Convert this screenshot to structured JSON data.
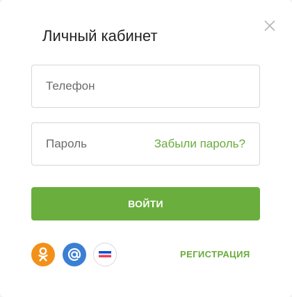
{
  "modal": {
    "title": "Личный кабинет"
  },
  "form": {
    "phone_placeholder": "Телефон",
    "password_placeholder": "Пароль",
    "forgot_label": "Забыли пароль?",
    "submit_label": "ВОЙТИ"
  },
  "footer": {
    "register_label": "РЕГИСТРАЦИЯ"
  },
  "social": [
    {
      "icon": "odnoklassniki-icon",
      "color": "#f39019"
    },
    {
      "icon": "mail-ru-icon",
      "color": "#3b7fd4"
    },
    {
      "icon": "gosuslugi-icon",
      "color": "#ffffff"
    }
  ],
  "colors": {
    "accent": "#6aae3e",
    "link": "#6aab3a",
    "border": "#d6d6d6"
  }
}
